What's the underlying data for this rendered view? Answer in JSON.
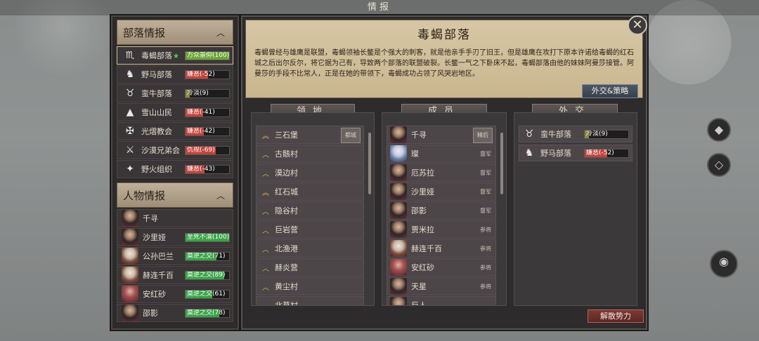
{
  "window": {
    "title": "情报"
  },
  "tribes": {
    "header": "部落情报",
    "items": [
      {
        "name": "毒蝎部落",
        "star": "★",
        "icon": "scorpion",
        "relation": "万众景仰(100)",
        "level": 1.0,
        "color": "#6da535",
        "selected": true
      },
      {
        "name": "野马部落",
        "icon": "horse",
        "relation": "嫌恶(-52)",
        "level": 0.52,
        "color": "#c2453c"
      },
      {
        "name": "蛮牛部落",
        "icon": "bull",
        "relation": "冷淡(9)",
        "level": 0.09,
        "color": "#8a8a3a"
      },
      {
        "name": "雪山山民",
        "icon": "mountain",
        "relation": "嫌恶(-41)",
        "level": 0.41,
        "color": "#c2453c"
      },
      {
        "name": "光熠教会",
        "icon": "church",
        "relation": "嫌恶(-42)",
        "level": 0.42,
        "color": "#c2453c"
      },
      {
        "name": "沙漠兄弟会",
        "icon": "swords",
        "relation": "仇视(-69)",
        "level": 0.69,
        "color": "#c2453c"
      },
      {
        "name": "野火组织",
        "icon": "flame",
        "relation": "嫌恶(-43)",
        "level": 0.43,
        "color": "#c2453c"
      }
    ]
  },
  "people": {
    "header": "人物情报",
    "items": [
      {
        "name": "千寻",
        "relation": "",
        "level": 0,
        "style": "dark"
      },
      {
        "name": "沙里娅",
        "relation": "至死不渝(100)",
        "level": 1.0,
        "style": "dark"
      },
      {
        "name": "公孙巴兰",
        "relation": "莫逆之交(71)",
        "level": 0.71,
        "style": "old"
      },
      {
        "name": "赫连千百",
        "relation": "莫逆之交(89)",
        "level": 0.89,
        "style": "old"
      },
      {
        "name": "安红砂",
        "relation": "莫逆之交(61)",
        "level": 0.61,
        "style": "red"
      },
      {
        "name": "邵影",
        "relation": "莫逆之交(78)",
        "level": 0.78,
        "style": "dark"
      }
    ]
  },
  "faction": {
    "title": "毒蝎部落",
    "description": "毒蝎曾经与雄鹰是联盟，毒蝎领袖长鳖是个强大的刺客，就是他亲手手刃了旧王，但是雄鹰在攻打下原本许诺给毒蝎的红石城之后出尔反尔，将它据为己有，导致两个部落的联盟破裂。长鳖一气之下卧床不起，毒蝎部落由他的妹妹阿曼莎接管。阿曼莎的手段不比常人，正是在她的带领下，毒蝎成功占领了风哭岩地区。",
    "diplomacy_button": "外交&策略",
    "disband_button": "解散势力"
  },
  "territory": {
    "header": "领地",
    "items": [
      {
        "name": "三石堡",
        "tag": "都城",
        "double": true
      },
      {
        "name": "古骸村",
        "tag": ""
      },
      {
        "name": "漠边村",
        "tag": ""
      },
      {
        "name": "红石城",
        "tag": "",
        "double": true
      },
      {
        "name": "隐谷村",
        "tag": ""
      },
      {
        "name": "巨岩营",
        "tag": ""
      },
      {
        "name": "北渔港",
        "tag": ""
      },
      {
        "name": "赫炎营",
        "tag": ""
      },
      {
        "name": "黄尘村",
        "tag": ""
      },
      {
        "name": "北草村",
        "tag": ""
      }
    ]
  },
  "members": {
    "header": "成员",
    "items": [
      {
        "name": "千寻",
        "rank": "精后",
        "style": "dark",
        "boxed": true
      },
      {
        "name": "璨",
        "rank": "督军",
        "style": "blue"
      },
      {
        "name": "厄苏拉",
        "rank": "督军",
        "style": "dark"
      },
      {
        "name": "沙里娅",
        "rank": "督军",
        "style": "dark"
      },
      {
        "name": "邵影",
        "rank": "督军",
        "style": "dark"
      },
      {
        "name": "贾米拉",
        "rank": "参将",
        "style": "dark"
      },
      {
        "name": "赫连千百",
        "rank": "参将",
        "style": "old"
      },
      {
        "name": "安红砂",
        "rank": "参将",
        "style": "red"
      },
      {
        "name": "天星",
        "rank": "参将",
        "style": "dark"
      },
      {
        "name": "巨人",
        "rank": "",
        "style": "dark"
      }
    ]
  },
  "diplomacy": {
    "header": "外交",
    "items": [
      {
        "name": "蛮牛部落",
        "icon": "bull",
        "relation": "冷淡(9)",
        "level": 0.09,
        "color": "#8a8a3a"
      },
      {
        "name": "野马部落",
        "icon": "horse",
        "relation": "嫌恶(-52)",
        "level": 0.52,
        "color": "#c2453c"
      }
    ]
  }
}
